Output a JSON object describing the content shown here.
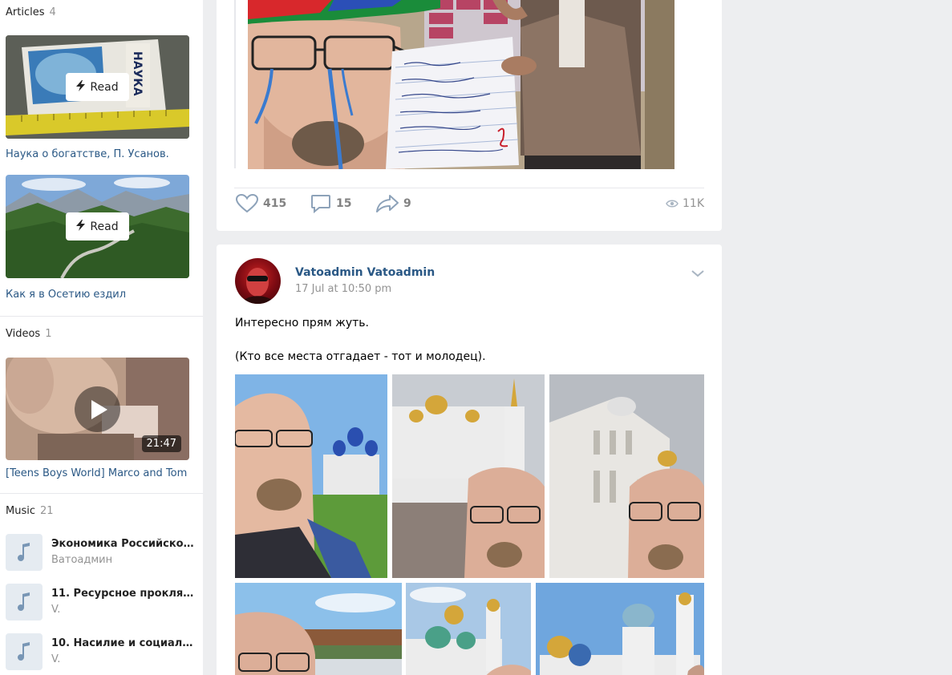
{
  "sidebar": {
    "articles": {
      "title": "Articles",
      "count": "4",
      "items": [
        {
          "read_label": "Read",
          "title": "Наука о богатстве, П. Усанов."
        },
        {
          "read_label": "Read",
          "title": "Как я в Осетию ездил"
        }
      ]
    },
    "videos": {
      "title": "Videos",
      "count": "1",
      "item": {
        "duration": "21:47",
        "title": "[Teens Boys World] Marco and Tom"
      }
    },
    "music": {
      "title": "Music",
      "count": "21",
      "tracks": [
        {
          "title": "Экономика Российской ...",
          "artist": "Ватоадмин"
        },
        {
          "title": "11. Ресурсное проклятие...",
          "artist": "V."
        },
        {
          "title": "10. Насилие и социальн...",
          "artist": "V."
        }
      ]
    }
  },
  "post1": {
    "likes": "415",
    "comments": "15",
    "shares": "9",
    "views": "11K"
  },
  "post2": {
    "author": "Vatoadmin Vatoadmin",
    "date": "17 Jul at 10:50 pm",
    "text": "Интересно прям жуть.\n\n(Кто все места отгадает - тот и молодец)."
  },
  "colors": {
    "link": "#2a5885",
    "muted": "#939393",
    "background": "#edeef0"
  }
}
